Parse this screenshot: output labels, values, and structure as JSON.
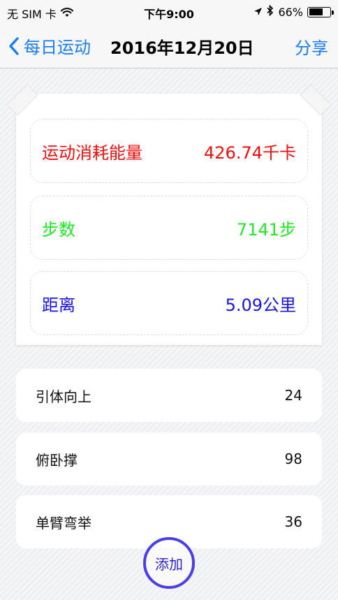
{
  "status_bar": {
    "carrier": "无 SIM 卡",
    "time": "下午9:00",
    "battery": "66%",
    "battery_level": 0.66
  },
  "nav": {
    "back_label": "每日运动",
    "title": "2016年12月20日",
    "share_label": "分享"
  },
  "summary": {
    "calories": {
      "label": "运动消耗能量",
      "value": "426.74千卡",
      "color": "#f20d0d"
    },
    "steps": {
      "label": "步数",
      "value": "7141步",
      "color": "#22e82a"
    },
    "distance": {
      "label": "距离",
      "value": "5.09公里",
      "color": "#1b14e0"
    }
  },
  "exercises": [
    {
      "name": "引体向上",
      "count": "24"
    },
    {
      "name": "俯卧撑",
      "count": "98"
    },
    {
      "name": "单臂弯举",
      "count": "36"
    }
  ],
  "add_button": {
    "label": "添加"
  },
  "colors": {
    "accent": "#1a7cf2",
    "add_ring": "#4a3fe6"
  }
}
